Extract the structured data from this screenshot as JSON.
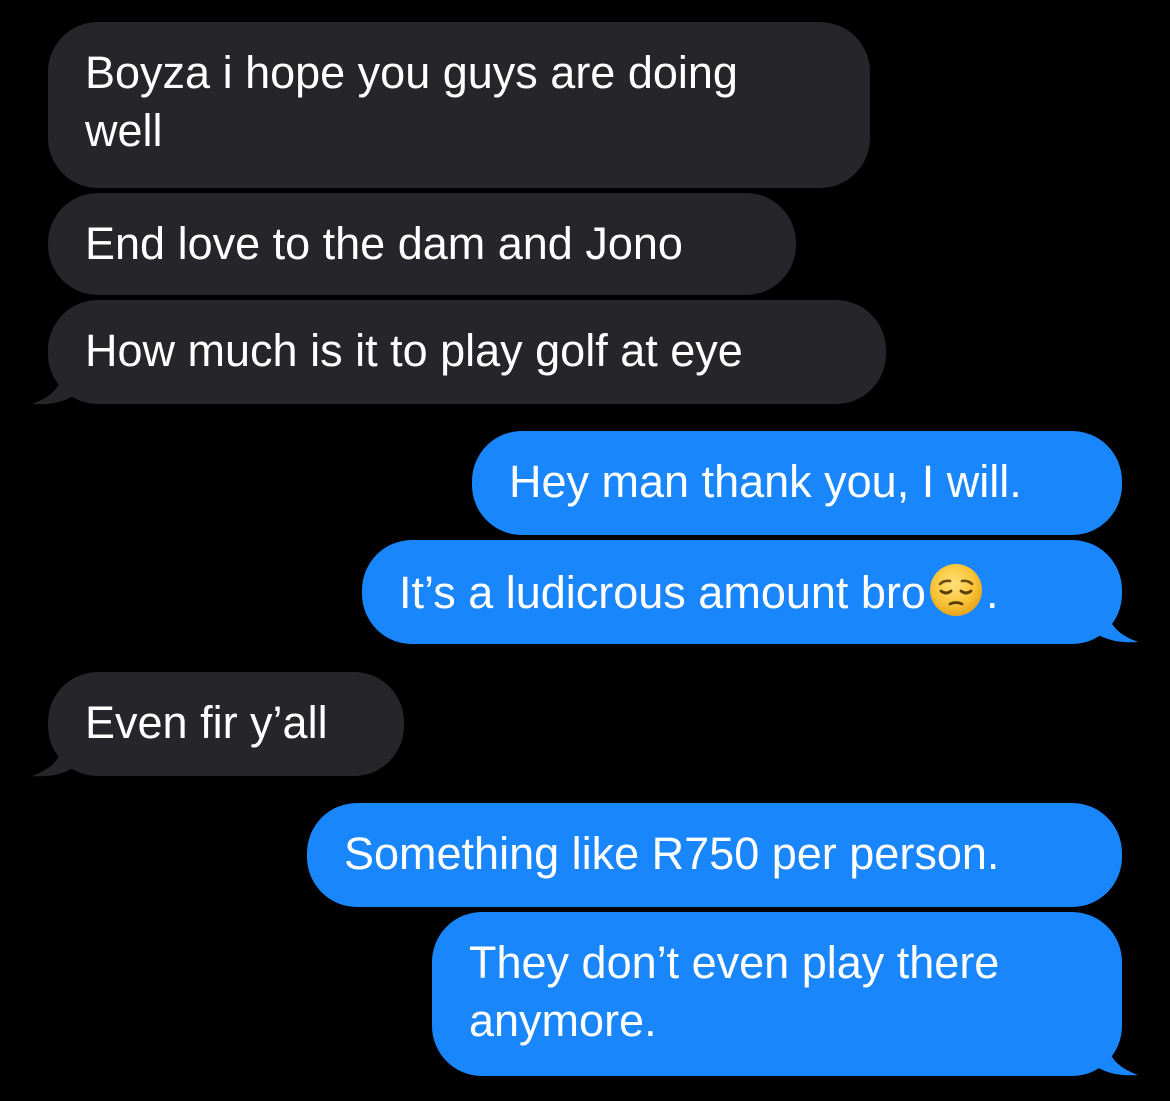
{
  "conversation": {
    "messages": [
      {
        "direction": "incoming",
        "text": "Boyza i hope you guys are doing\nwell"
      },
      {
        "direction": "incoming",
        "text": "End love to the dam and Jono"
      },
      {
        "direction": "incoming",
        "text": "How much is it to play golf at eye"
      },
      {
        "direction": "outgoing",
        "text": "Hey man thank you, I will."
      },
      {
        "direction": "outgoing",
        "text_before": "It’s a ludicrous amount bro",
        "emoji": "pensive-face",
        "text_after": "."
      },
      {
        "direction": "incoming",
        "text": "Even fir y’all"
      },
      {
        "direction": "outgoing",
        "text": "Something like R750 per person."
      },
      {
        "direction": "outgoing",
        "text": "They don’t even play there\nanymore."
      }
    ]
  },
  "colors": {
    "background": "#000000",
    "incoming_bubble": "#26252a",
    "outgoing_bubble": "#1a86fb",
    "text": "#ffffff"
  }
}
